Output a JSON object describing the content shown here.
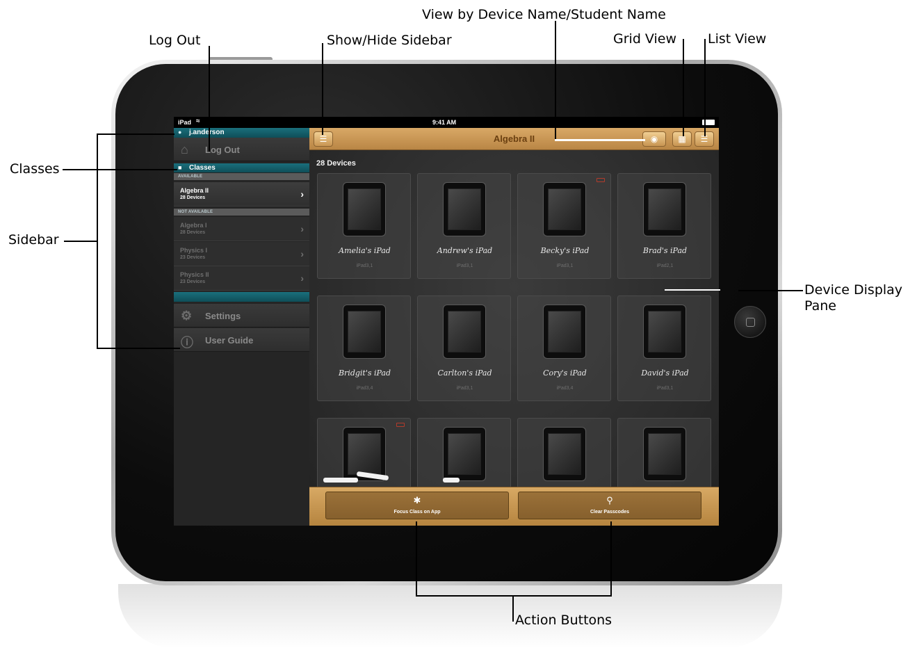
{
  "callouts": {
    "log_out": "Log Out",
    "show_hide_sidebar": "Show/Hide Sidebar",
    "view_by_name": "View by Device Name/Student Name",
    "grid_view": "Grid View",
    "list_view": "List View",
    "classes": "Classes",
    "sidebar": "Sidebar",
    "device_display_pane_line1": "Device Display",
    "device_display_pane_line2": "Pane",
    "action_buttons": "Action Buttons"
  },
  "status_bar": {
    "carrier": "iPad",
    "time": "9:41 AM"
  },
  "sidebar": {
    "username": "j.anderson",
    "log_out": "Log Out",
    "classes_header": "Classes",
    "available_label": "AVAILABLE",
    "not_available_label": "NOT AVAILABLE",
    "available_classes": [
      {
        "name": "Algebra II",
        "count": "28 Devices"
      }
    ],
    "unavailable_classes": [
      {
        "name": "Algebra I",
        "count": "28 Devices"
      },
      {
        "name": "Physics I",
        "count": "23 Devices"
      },
      {
        "name": "Physics II",
        "count": "23 Devices"
      }
    ],
    "settings": "Settings",
    "user_guide": "User Guide"
  },
  "toolbar": {
    "title": "Algebra II"
  },
  "main": {
    "device_count": "28 Devices",
    "devices": [
      {
        "name": "Amelia's iPad",
        "model": "iPad3,1"
      },
      {
        "name": "Andrew's iPad",
        "model": "iPad3,1"
      },
      {
        "name": "Becky's iPad",
        "model": "iPad3,1"
      },
      {
        "name": "Brad's iPad",
        "model": "iPad2,1"
      },
      {
        "name": "Bridgit's iPad",
        "model": "iPad3,4"
      },
      {
        "name": "Carlton's iPad",
        "model": "iPad3,1"
      },
      {
        "name": "Cory's iPad",
        "model": "iPad3,4"
      },
      {
        "name": "David's iPad",
        "model": "iPad3,1"
      }
    ]
  },
  "actions": {
    "focus_class": "Focus Class on App",
    "clear_passcodes": "Clear Passcodes"
  },
  "colors": {
    "accent_teal": "#14616d",
    "wood": "#c9975a",
    "sidebar_bg": "#252525"
  },
  "icons": [
    "person-icon",
    "home-icon",
    "classes-icon",
    "chevron-right-icon",
    "gear-icon",
    "info-icon",
    "menu-icon",
    "eye-icon",
    "grid-icon",
    "list-icon",
    "app-store-icon",
    "key-icon",
    "wifi-icon",
    "battery-icon"
  ]
}
